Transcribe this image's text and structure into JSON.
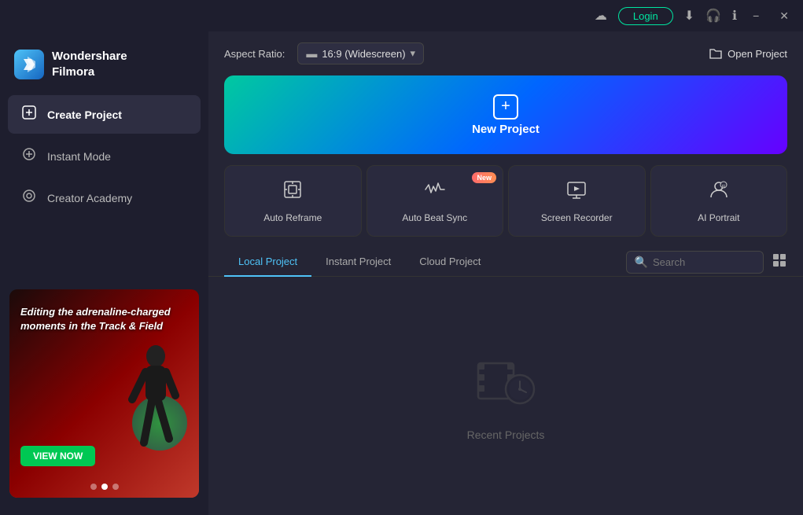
{
  "titleBar": {
    "loginLabel": "Login",
    "minimizeLabel": "−",
    "closeLabel": "✕"
  },
  "sidebar": {
    "logoName": "Wondershare\nFilmora",
    "logoLine1": "Wondershare",
    "logoLine2": "Filmora",
    "items": [
      {
        "id": "create-project",
        "label": "Create Project",
        "icon": "➕",
        "active": true
      },
      {
        "id": "instant-mode",
        "label": "Instant Mode",
        "icon": "⊕",
        "active": false
      },
      {
        "id": "creator-academy",
        "label": "Creator Academy",
        "icon": "◎",
        "active": false
      }
    ],
    "promo": {
      "text": "Editing the adrenaline-charged moments in the Track & Field",
      "buttonLabel": "VIEW NOW"
    }
  },
  "content": {
    "aspectRatioLabel": "Aspect Ratio:",
    "aspectRatioValue": "16:9 (Widescreen)",
    "openProjectLabel": "Open Project",
    "newProjectLabel": "New Project",
    "featureCards": [
      {
        "id": "auto-reframe",
        "label": "Auto Reframe",
        "icon": "reframe",
        "badge": null
      },
      {
        "id": "auto-beat-sync",
        "label": "Auto Beat Sync",
        "icon": "beat",
        "badge": "New"
      },
      {
        "id": "screen-recorder",
        "label": "Screen Recorder",
        "icon": "screen",
        "badge": null
      },
      {
        "id": "ai-portrait",
        "label": "AI Portrait",
        "icon": "portrait",
        "badge": null
      }
    ],
    "projectTabs": [
      {
        "id": "local",
        "label": "Local Project",
        "active": true
      },
      {
        "id": "instant",
        "label": "Instant Project",
        "active": false
      },
      {
        "id": "cloud",
        "label": "Cloud Project",
        "active": false
      }
    ],
    "searchPlaceholder": "Search",
    "recentProjectsLabel": "Recent Projects"
  }
}
